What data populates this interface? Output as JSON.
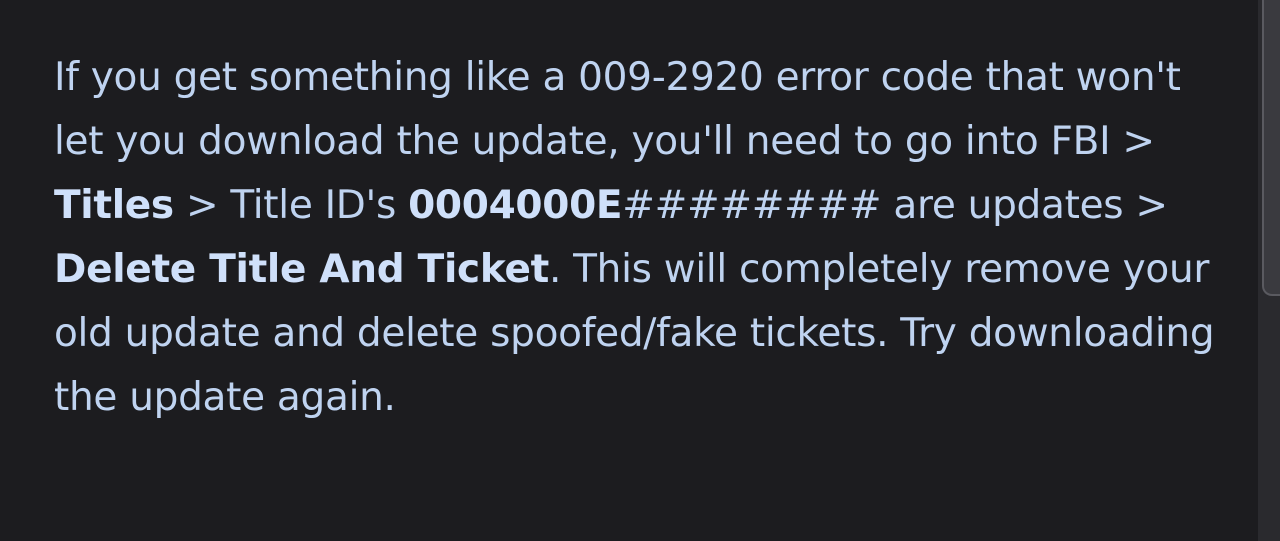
{
  "post": {
    "segments": [
      {
        "text": "If you get something like a 009-2920 error code that won't let you download the update, you'll need to go into FBI > ",
        "bold": false
      },
      {
        "text": "Titles",
        "bold": true
      },
      {
        "text": " > Title ID's ",
        "bold": false
      },
      {
        "text": "0004000E",
        "bold": true
      },
      {
        "text": "######## are updates > ",
        "bold": false
      },
      {
        "text": "Delete Title And Ticket",
        "bold": true
      },
      {
        "text": ". This will completely remove your old update and delete spoofed/fake tickets. Try downloading the update again.",
        "bold": false
      }
    ]
  },
  "colors": {
    "background": "#1c1c1f",
    "text": "#bfd3f0",
    "scrollbar": "#3a3a3f"
  }
}
